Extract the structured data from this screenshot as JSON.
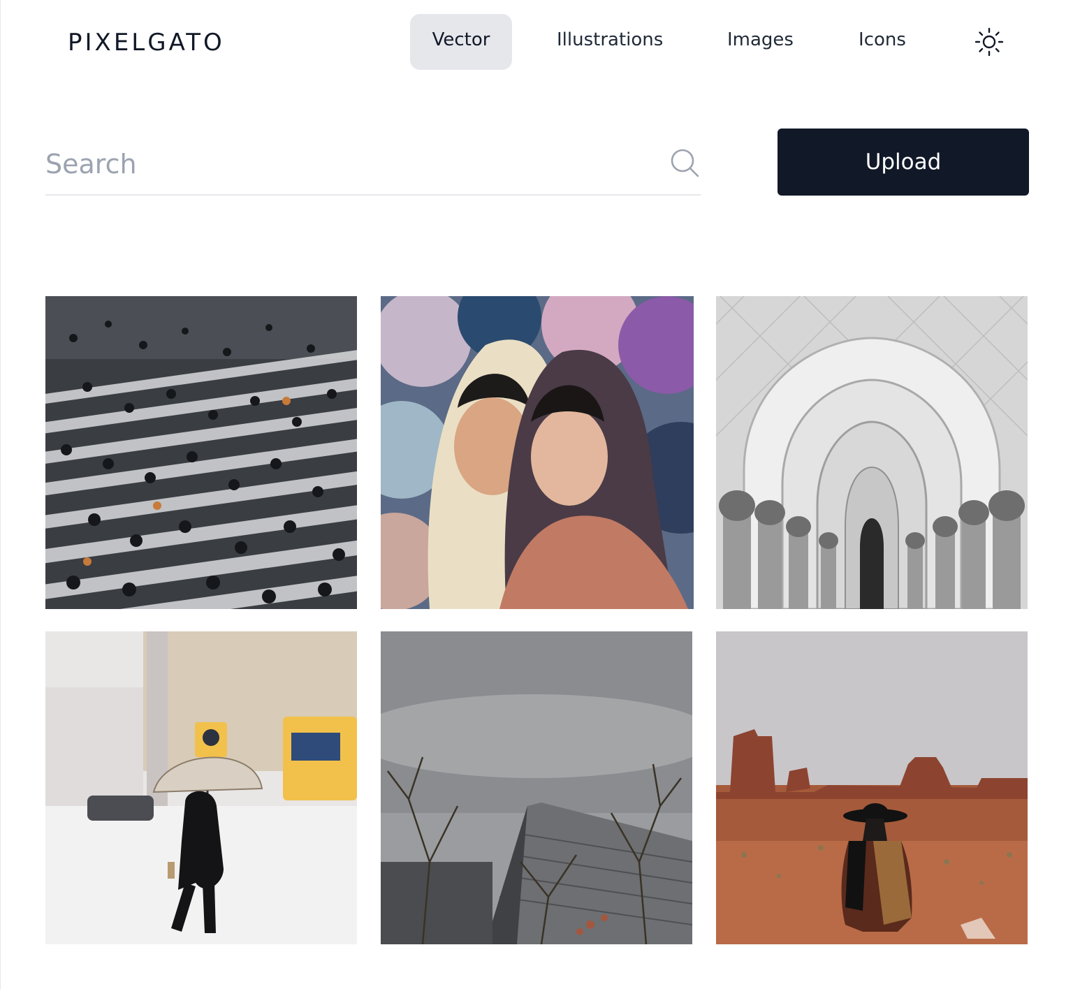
{
  "brand": {
    "name": "PIXELGATO"
  },
  "nav": {
    "items": [
      {
        "label": "Vector",
        "active": true
      },
      {
        "label": "Illustrations",
        "active": false
      },
      {
        "label": "Images",
        "active": false
      },
      {
        "label": "Icons",
        "active": false
      }
    ],
    "theme_icon": "sun-icon"
  },
  "search": {
    "placeholder": "Search",
    "value": "",
    "icon": "search-icon"
  },
  "upload": {
    "label": "Upload"
  },
  "colors": {
    "primary": "#111827",
    "nav_active_bg": "#e5e7eb",
    "placeholder": "#9ca3af"
  },
  "gallery": {
    "items": [
      {
        "subject": "crowd-crosswalk"
      },
      {
        "subject": "two-women-headscarves"
      },
      {
        "subject": "mosque-arches"
      },
      {
        "subject": "snow-umbrella-street"
      },
      {
        "subject": "temple-roof-bare-trees"
      },
      {
        "subject": "desert-woman-hat"
      }
    ]
  }
}
